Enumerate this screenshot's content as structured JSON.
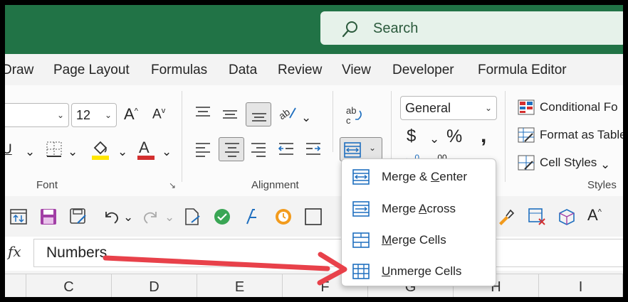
{
  "search": {
    "label": "Search"
  },
  "tabs": [
    "Draw",
    "Page Layout",
    "Formulas",
    "Data",
    "Review",
    "View",
    "Developer",
    "Formula Editor"
  ],
  "font": {
    "size": "12",
    "group_label": "Font"
  },
  "alignment": {
    "group_label": "Alignment"
  },
  "number": {
    "format": "General",
    "dec_left": "←.0",
    "dec_right": ".00"
  },
  "styles": {
    "conditional": "Conditional Fo",
    "format_table": "Format as Table",
    "cell_styles": "Cell Styles",
    "group_label": "Styles"
  },
  "merge_menu": {
    "items": [
      {
        "prefix": "Merge & ",
        "accel": "C",
        "suffix": "enter"
      },
      {
        "prefix": "Merge ",
        "accel": "A",
        "suffix": "cross"
      },
      {
        "prefix": "",
        "accel": "M",
        "suffix": "erge Cells"
      },
      {
        "prefix": "",
        "accel": "U",
        "suffix": "nmerge Cells"
      }
    ]
  },
  "formula_bar": {
    "fx": "fx",
    "value": "Numbers"
  },
  "columns": [
    "C",
    "D",
    "E",
    "F",
    "G",
    "H",
    "I"
  ],
  "colors": {
    "excel_green": "#217346",
    "arrow": "#e8414a",
    "merge_icon": "#1f6fbf",
    "font_red": "#d32f2f",
    "highlight_yellow": "#ffe600"
  }
}
